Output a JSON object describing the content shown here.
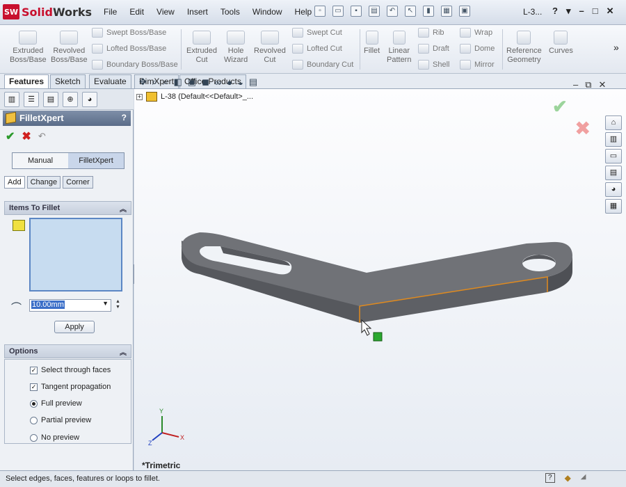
{
  "app": {
    "logo_prefix": "Solid",
    "logo_suffix": "Works",
    "logo_badge": "SW",
    "doc_title": "L-3..."
  },
  "menu": [
    "File",
    "Edit",
    "View",
    "Insert",
    "Tools",
    "Window",
    "Help"
  ],
  "window_controls": {
    "help": "?",
    "menu": "▾",
    "minimize": "–",
    "restore": "□",
    "close": "✕"
  },
  "ribbon": {
    "extruded_boss": [
      "Extruded",
      "Boss/Base"
    ],
    "revolved_boss": [
      "Revolved",
      "Boss/Base"
    ],
    "swept_boss": "Swept Boss/Base",
    "lofted_boss": "Lofted Boss/Base",
    "boundary_boss": "Boundary Boss/Base",
    "extruded_cut": [
      "Extruded",
      "Cut"
    ],
    "hole_wizard": [
      "Hole",
      "Wizard"
    ],
    "revolved_cut": [
      "Revolved",
      "Cut"
    ],
    "swept_cut": "Swept Cut",
    "lofted_cut": "Lofted Cut",
    "boundary_cut": "Boundary Cut",
    "fillet": "Fillet",
    "linear_pattern": [
      "Linear",
      "Pattern"
    ],
    "rib": "Rib",
    "draft": "Draft",
    "shell": "Shell",
    "wrap": "Wrap",
    "dome": "Dome",
    "mirror": "Mirror",
    "reference_geometry": [
      "Reference",
      "Geometry"
    ],
    "curves": "Curves",
    "overflow": "»"
  },
  "tabs": [
    "Features",
    "Sketch",
    "Evaluate",
    "DimXpert",
    "Office Products"
  ],
  "panel": {
    "title": "FilletXpert",
    "help": "?",
    "modes": [
      "Manual",
      "FilletXpert"
    ],
    "subtabs": [
      "Add",
      "Change",
      "Corner"
    ],
    "items_section": "Items To Fillet",
    "radius_value": "10.00mm",
    "apply_label": "Apply",
    "options_section": "Options",
    "options": [
      {
        "label": "Select through faces",
        "checked": true
      },
      {
        "label": "Tangent propagation",
        "checked": true
      }
    ],
    "preview": [
      {
        "label": "Full preview",
        "selected": true
      },
      {
        "label": "Partial preview",
        "selected": false
      },
      {
        "label": "No preview",
        "selected": false
      }
    ]
  },
  "viewport": {
    "tree_label": "L-38  (Default<<Default>_...",
    "view_name": "*Trimetric",
    "axes": {
      "x": "X",
      "y": "Y",
      "z": "Z"
    },
    "part_color": "#6b6d72",
    "edge_color": "#e08a1e"
  },
  "status": {
    "message": "Select edges, faces, features or loops to fillet."
  },
  "colors": {
    "accent": "#3a6ec8",
    "ok": "#2c9a2c",
    "cancel": "#d02020",
    "handle": "#2aa830"
  }
}
